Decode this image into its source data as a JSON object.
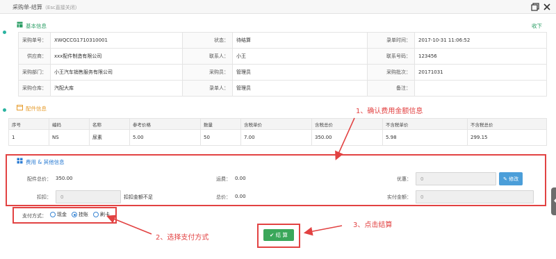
{
  "window": {
    "title": "采购单-结算",
    "hint": "（Esc直接关闭）"
  },
  "basic": {
    "section_title": "基本信息",
    "collapse_label": "收下",
    "rows": [
      [
        [
          "采购单号：",
          "XWQCCG1710310001"
        ],
        [
          "状态：",
          "待结算"
        ],
        [
          "录单时间：",
          "2017-10-31 11:06:52"
        ]
      ],
      [
        [
          "供应商：",
          "xxx配件制造有限公司"
        ],
        [
          "联系人：",
          "小王"
        ],
        [
          "联系号码：",
          "123456"
        ]
      ],
      [
        [
          "采购部门：",
          "小王汽车销售服务有限公司"
        ],
        [
          "采购员：",
          "管理员"
        ],
        [
          "采购批次：",
          "20171031"
        ]
      ],
      [
        [
          "采购仓库：",
          "汽配大库"
        ],
        [
          "录单人：",
          "管理员"
        ],
        [
          "备注：",
          ""
        ]
      ]
    ]
  },
  "parts": {
    "section_title": "配件信息",
    "headers": [
      "序号",
      "编码",
      "名称",
      "参考价格",
      "数量",
      "含税单价",
      "含税总价",
      "不含税单价",
      "不含税总价"
    ],
    "rows": [
      [
        "1",
        "NS",
        "尿素",
        "5.00",
        "50",
        "7.00",
        "350.00",
        "5.98",
        "299.15"
      ]
    ]
  },
  "fees": {
    "section_title": "费用 & 其他信息",
    "parts_total_label": "配件总价：",
    "parts_total_value": "350.00",
    "freight_label": "运费：",
    "freight_value": "0.00",
    "discount_label": "优惠：",
    "discount_value": "0",
    "modify_label": "修改",
    "deduct_label": "扣扣：",
    "deduct_value": "0",
    "deduct_note": "扣扣金额不足",
    "total_label": "总价：",
    "total_value": "0.00",
    "paid_label": "实付金额：",
    "paid_value": "0"
  },
  "payment": {
    "label": "支付方式：",
    "options": [
      "现金",
      "挂账",
      "刷卡"
    ],
    "selected": "挂账"
  },
  "settle_button": "结 算",
  "annotations": {
    "step1": "1、确认费用金额信息",
    "step2": "2、选择支付方式",
    "step3": "3、点击结算"
  },
  "colors": {
    "accent_green": "#3aa75a",
    "annotation_red": "#e24242",
    "link_blue": "#3a86d4"
  }
}
